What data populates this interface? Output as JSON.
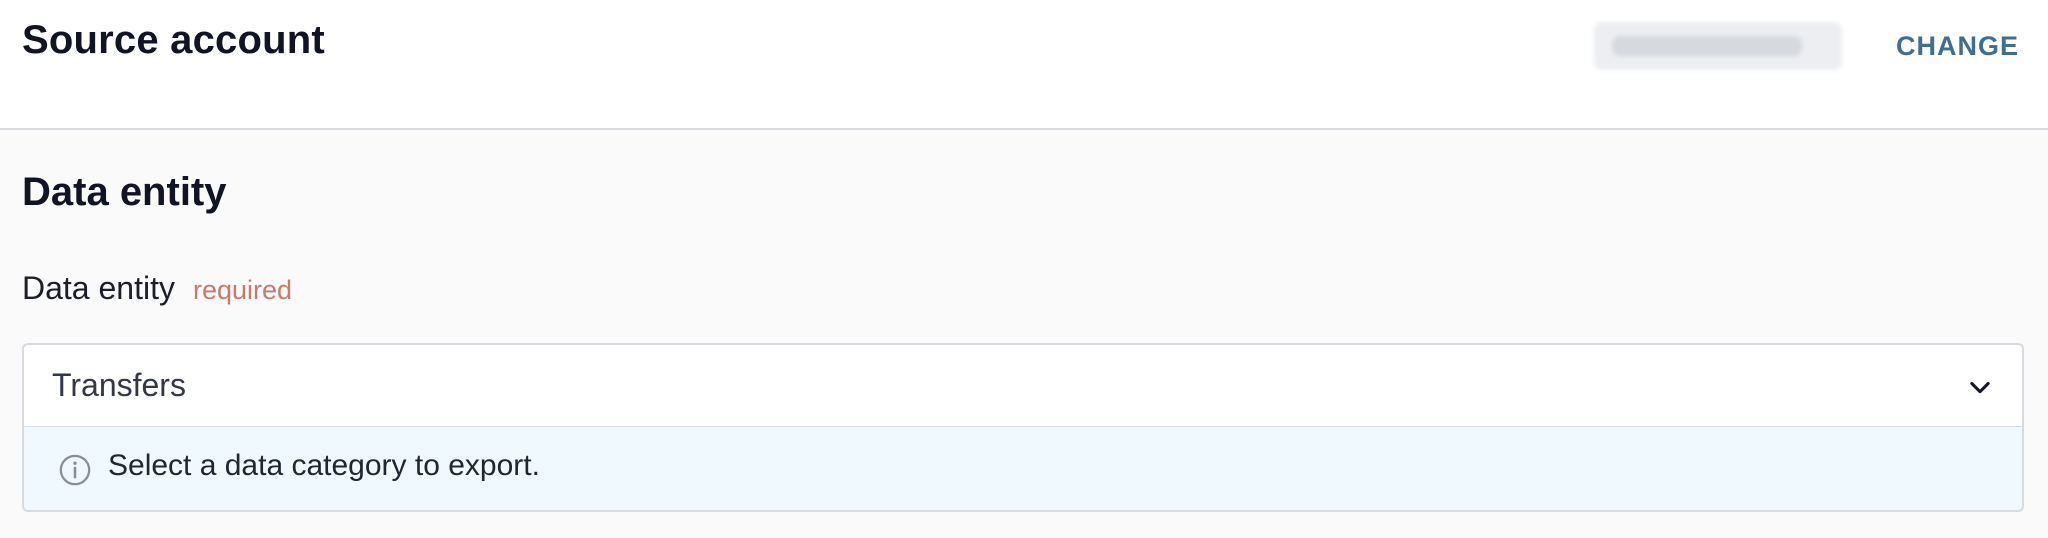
{
  "source_account": {
    "title": "Source account",
    "change_label": "CHANGE"
  },
  "data_entity_section": {
    "title": "Data entity",
    "field": {
      "label": "Data entity",
      "required_tag": "required",
      "selected_value": "Transfers",
      "hint": "Select a data category to export."
    }
  },
  "icons": {
    "dropdown": "chevron-down-icon",
    "hint": "info-icon"
  },
  "colors": {
    "accent": "#3f6e95",
    "required": "#c9796a",
    "hint_background": "#f0f9fd"
  }
}
